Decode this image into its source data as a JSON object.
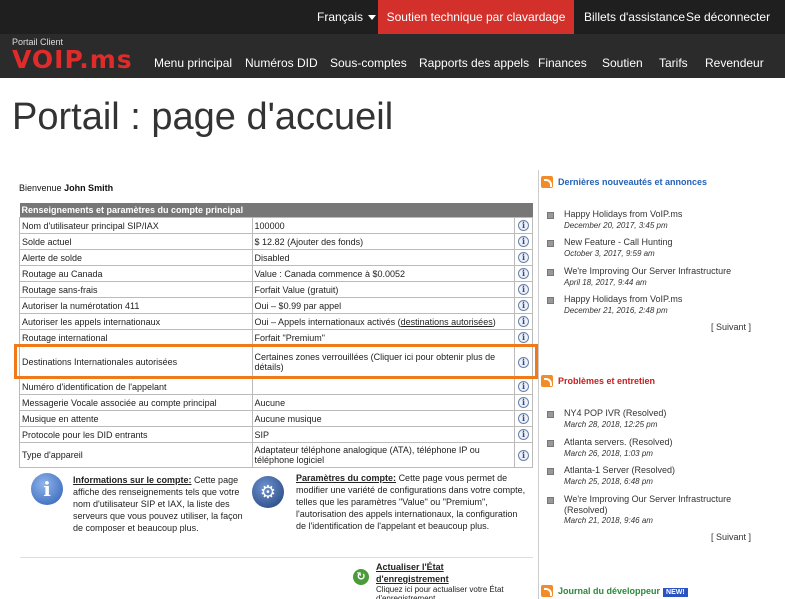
{
  "topbar": {
    "language": "Français",
    "chat": "Soutien technique par clavardage",
    "tickets": "Billets d'assistance",
    "logout": "Se déconnecter"
  },
  "logo": {
    "sub": "Portail Client",
    "brand": "VOIP.ms"
  },
  "nav": [
    "Menu principal",
    "Numéros DID",
    "Sous-comptes",
    "Rapports des appels",
    "Finances",
    "Soutien",
    "Tarifs",
    "Revendeur"
  ],
  "page_title": "Portail : page d'accueil",
  "welcome": {
    "prefix": "Bienvenue",
    "name": "John Smith"
  },
  "account": {
    "header": "Renseignements et paramètres du compte principal",
    "rows": [
      {
        "label": "Nom d'utilisateur principal SIP/IAX",
        "value": "100000"
      },
      {
        "label": "Solde actuel",
        "value": "$ 12.82 (Ajouter des fonds)"
      },
      {
        "label": "Alerte de solde",
        "value": "Disabled"
      },
      {
        "label": "Routage au Canada",
        "value": "Value : Canada commence à $0.0052"
      },
      {
        "label": "Routage sans-frais",
        "value": "Forfait Value (gratuit)"
      },
      {
        "label": "Autoriser la numérotation 411",
        "value": "Oui – $0.99 par appel"
      },
      {
        "label": "Autoriser les appels internationaux",
        "value": "Oui – Appels internationaux activés (",
        "link": "destinations autorisées",
        "suffix": ")"
      },
      {
        "label": "Routage international",
        "value": "Forfait \"Premium\""
      },
      {
        "label": "Destinations Internationales autorisées",
        "value": "Certaines zones verrouillées (Cliquer ici pour obtenir plus de détails)"
      },
      {
        "label": "Numéro d'identification de l'appelant",
        "value": ""
      },
      {
        "label": "Messagerie Vocale associée au compte principal",
        "value": "Aucune"
      },
      {
        "label": "Musique en attente",
        "value": "Aucune musique"
      },
      {
        "label": "Protocole pour les DID entrants",
        "value": "SIP"
      },
      {
        "label": "Type d'appareil",
        "value": "Adaptateur téléphone analogique (ATA), téléphone IP ou téléphone logiciel"
      }
    ]
  },
  "info_block": {
    "title": "Informations sur le compte:",
    "text": "Cette page affiche des renseignements tels que votre nom d'utilisateur SIP et IAX, la liste des serveurs que vous pouvez utiliser, la façon de composer et beaucoup plus."
  },
  "params_block": {
    "title": "Paramètres du compte:",
    "text": "Cette page vous permet de modifier une variété de configurations dans votre compte, telles que les paramètres \"Value\" ou \"Premium\", l'autorisation des appels internationaux, la configuration de l'identification de l'appelant et beaucoup plus."
  },
  "refresh_block": {
    "title": "Actualiser l'État d'enregistrement",
    "text": "Cliquez ici pour actualiser votre État d'enregistrement."
  },
  "news": {
    "title": "Dernières nouveautés et annonces",
    "items": [
      {
        "title": "Happy Holidays from VoIP.ms",
        "date": "December 20, 2017, 3:45 pm"
      },
      {
        "title": "New Feature - Call Hunting",
        "date": "October 3, 2017, 9:59 am"
      },
      {
        "title": "We're Improving Our Server Infrastructure",
        "date": "April 18, 2017, 9:44 am"
      },
      {
        "title": "Happy Holidays from VoIP.ms",
        "date": "December 21, 2016, 2:48 pm"
      }
    ],
    "next": "[ Suivant ]"
  },
  "issues": {
    "title": "Problèmes et entretien",
    "items": [
      {
        "title": "NY4 POP IVR (Resolved)",
        "date": "March 28, 2018, 12:25 pm"
      },
      {
        "title": "Atlanta servers. (Resolved)",
        "date": "March 26, 2018, 1:03 pm"
      },
      {
        "title": "Atlanta-1 Server (Resolved)",
        "date": "March 25, 2018, 6:48 pm"
      },
      {
        "title": "We're Improving Our Server Infrastructure (Resolved)",
        "date": "March 21, 2018, 9:46 am"
      }
    ],
    "next": "[ Suivant ]"
  },
  "dev": {
    "title": "Journal du développeur",
    "badge": "NEW!"
  },
  "colors": {
    "accent_red": "#d4302b",
    "highlight_orange": "#f07a1a",
    "link_blue": "#2462b6"
  }
}
